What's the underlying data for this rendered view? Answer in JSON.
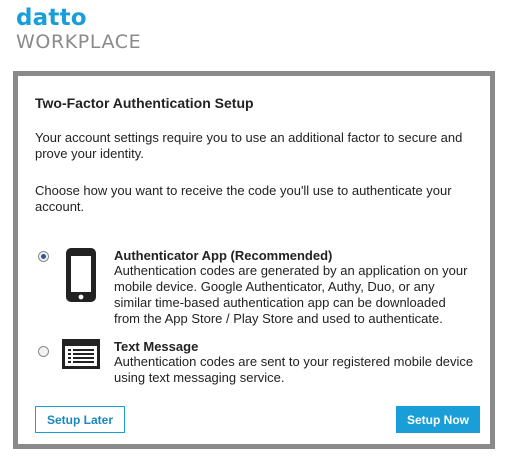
{
  "logo": {
    "top": "datto",
    "bottom": "WORKPLACE"
  },
  "dialog": {
    "title": "Two-Factor Authentication Setup",
    "intro": "Your account settings require you to use an additional factor to secure and prove your identity.",
    "prompt": "Choose how you want to receive the code you'll use to authenticate your account."
  },
  "options": [
    {
      "title": "Authenticator App (Recommended)",
      "description": "Authentication codes are generated by an application on your mobile device. Google Authenticator, Authy, Duo, or any similar time-based authentication app can be downloaded from the App Store / Play Store and used to authenticate.",
      "selected": true,
      "icon": "mobile-phone-icon"
    },
    {
      "title": "Text Message",
      "description": "Authentication codes are sent to your registered mobile device using text messaging service.",
      "selected": false,
      "icon": "text-message-icon"
    }
  ],
  "buttons": {
    "later": "Setup Later",
    "now": "Setup Now"
  },
  "colors": {
    "brand": "#199ed8",
    "logo_gray": "#8a8a8a",
    "panel_border": "#8a8a8a",
    "radio_fill": "#2d5a8f",
    "text": "#222222"
  }
}
